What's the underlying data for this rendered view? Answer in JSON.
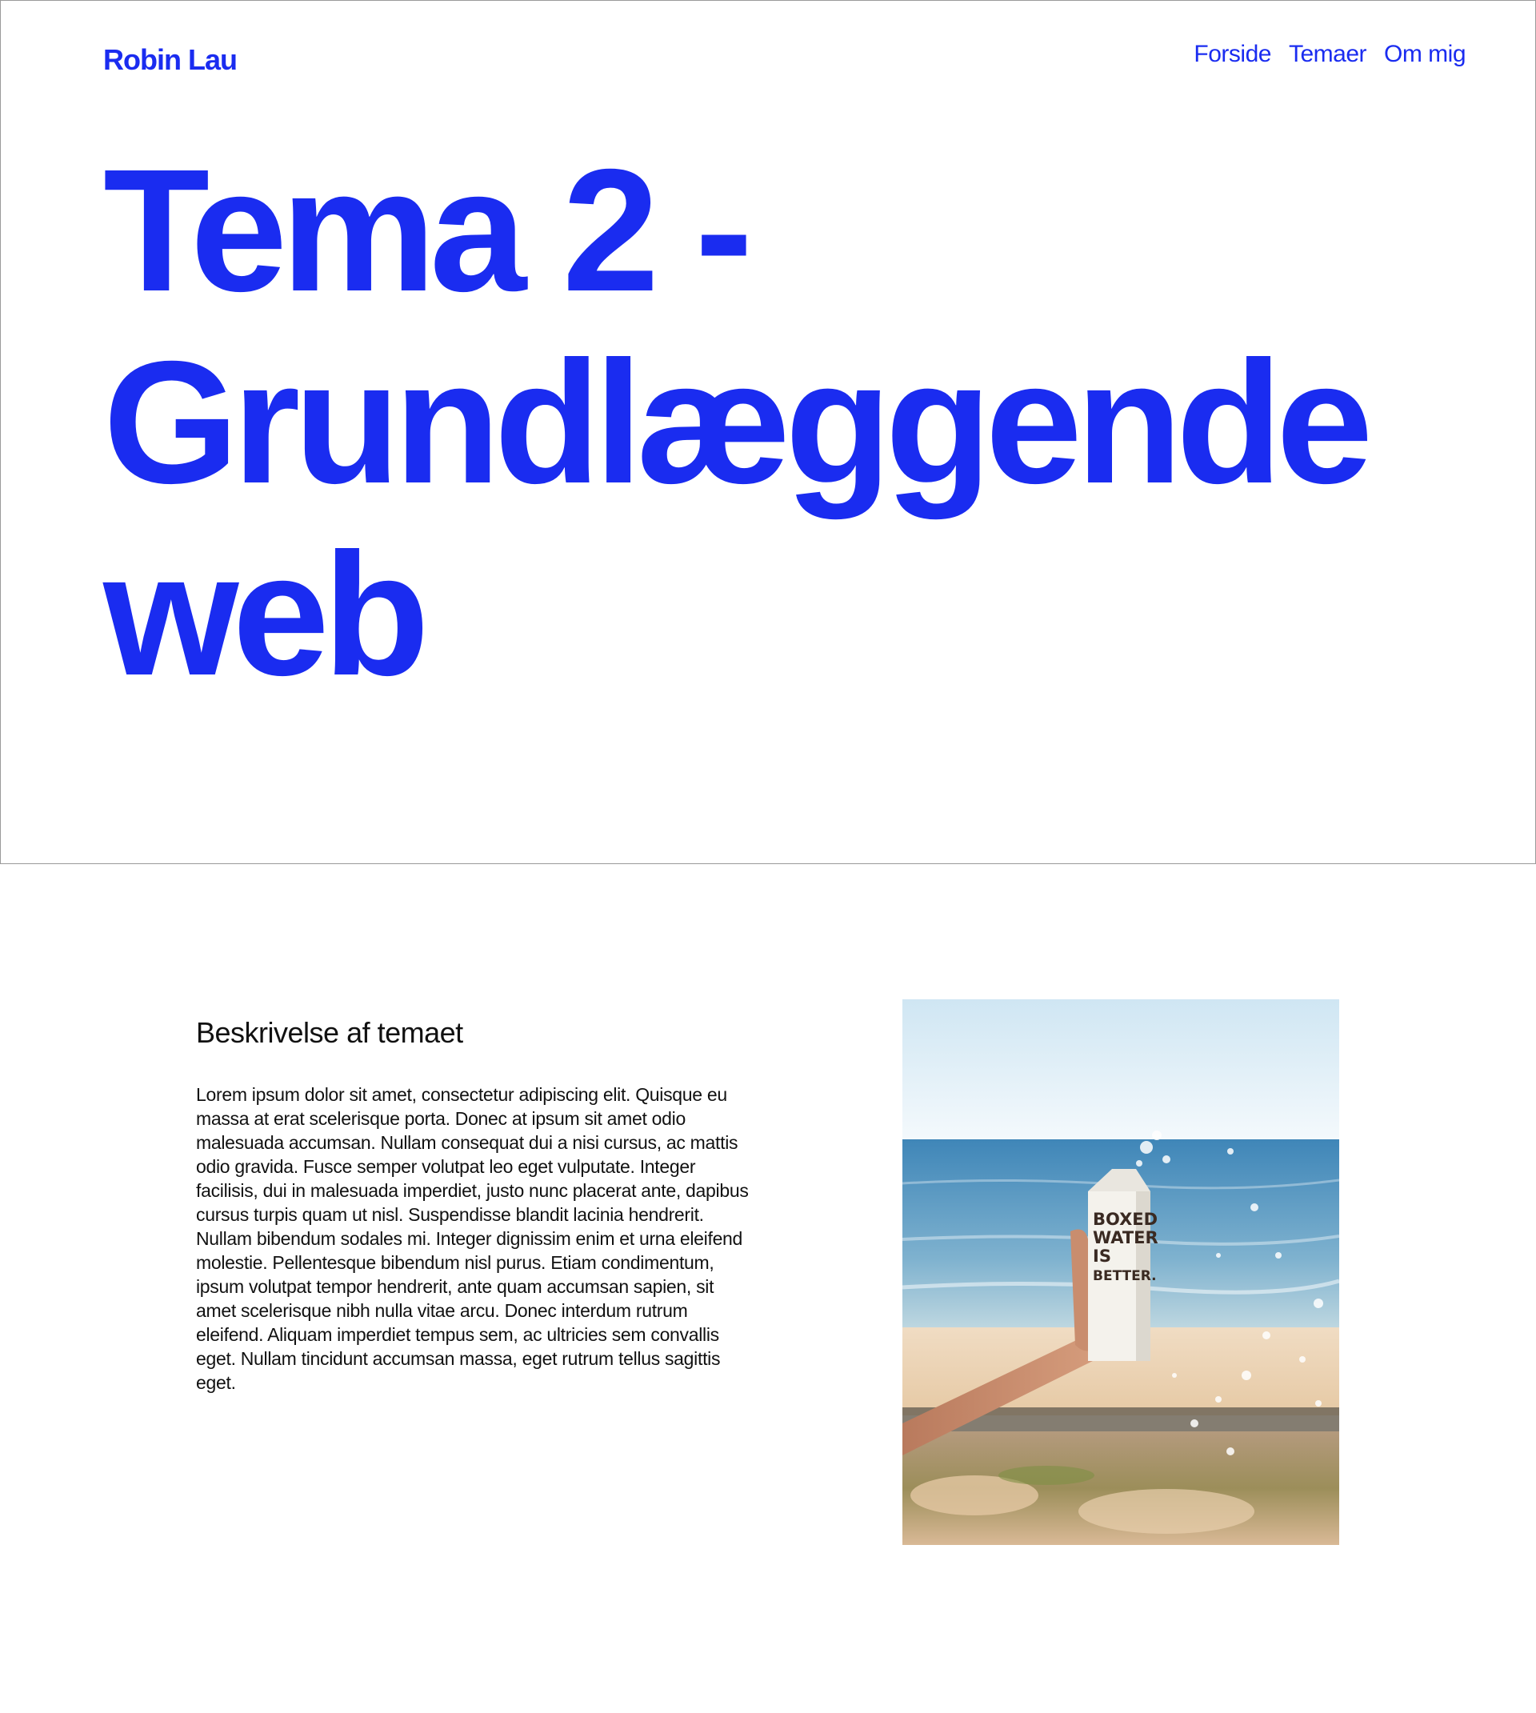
{
  "header": {
    "brand": "Robin Lau",
    "nav": [
      "Forside",
      "Temaer",
      "Om mig"
    ]
  },
  "hero": {
    "title_lines": [
      "Tema 2 -",
      "Grundlæggende",
      "web"
    ]
  },
  "content": {
    "heading": "Beskrivelse af temaet",
    "body": "Lorem ipsum dolor sit amet, consectetur adipiscing elit. Quisque eu massa at erat scelerisque porta. Donec at ipsum sit amet odio malesuada accumsan. Nullam consequat dui a nisi cursus, ac mattis odio gravida. Fusce semper volutpat leo eget vulputate. Integer facilisis, dui in malesuada imperdiet, justo nunc placerat ante, dapibus cursus turpis quam ut nisl. Suspendisse blandit lacinia hendrerit. Nullam bibendum sodales mi. Integer dignissim enim et urna eleifend molestie. Pellentesque bibendum nisl purus. Etiam condimentum, ipsum volutpat tempor hendrerit, ante quam accumsan sapien, sit amet scelerisque nibh nulla vitae arcu. Donec interdum rutrum eleifend. Aliquam imperdiet tempus sem, ac ultricies sem convallis eget. Nullam tincidunt accumsan massa, eget rutrum tellus sagittis eget."
  },
  "photo": {
    "carton_text": [
      "BOXED",
      "WATER",
      "IS",
      "BETTER."
    ]
  },
  "colors": {
    "accent": "#1a2cf0",
    "text": "#111111",
    "background": "#ffffff",
    "hero_border": "#9a9a9a"
  }
}
